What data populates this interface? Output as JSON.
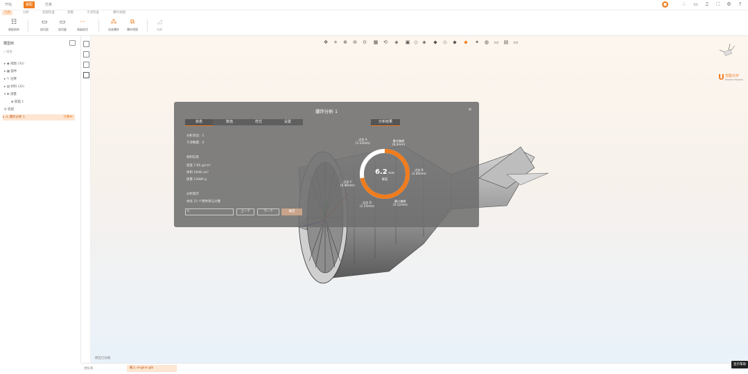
{
  "topbar": {
    "tabs": [
      "开始",
      "装配",
      "仿真",
      "渲染",
      "显示",
      "工具",
      "视图"
    ],
    "active_tab": "装配"
  },
  "ribbon": {
    "subtabs": [
      "几何",
      "分析",
      "装配检查",
      "测量",
      "干涉检查",
      "爆炸视图"
    ],
    "buttons": [
      "装配结构",
      "剖切面",
      "剖切盒",
      "高级剖切",
      "动态爆炸",
      "爆炸视图",
      "隐藏"
    ]
  },
  "left_panel": {
    "title": "模型树",
    "search_placeholder": "搜索",
    "tree_items": [
      "视图 (32)",
      "部件",
      "注释",
      "材料 (32)",
      "测量",
      "剖面 1",
      "装配",
      "爆炸分析 1"
    ],
    "selected_tag": "计算中"
  },
  "dialog": {
    "title": "爆炸分析 1",
    "tabs": [
      "状态",
      "数值",
      "样式",
      "设置"
    ],
    "right_tab": "分析结果",
    "lines": [
      "分析状态：1",
      "干涉数量：0",
      "材料信息",
      "密度 7.85 g/cm³",
      "体积 1648 cm³",
      "质量 12680 g",
      "分析提示",
      "共有 15 个零件参与计算"
    ],
    "input_value": "0",
    "buttons": [
      "上一个",
      "下一个",
      "确定"
    ],
    "gauge": {
      "value": "6.2",
      "unit": "mm",
      "caption": "偏差",
      "fraction": 0.72
    },
    "point_labels": [
      "点位 A\n(1.12mm)",
      "最大偏差\n(6.2mm)",
      "点位 B\n(3.40mm)",
      "点位 C\n(0.86mm)",
      "点位 D\n(2.15mm)",
      "最小偏差\n(0.12mm)"
    ]
  },
  "viewport": {
    "logo_text": "优联元宇",
    "logo_sub": "YouLian Universe",
    "bottom_label": "模型已加载"
  },
  "statusbar": {
    "left_text": "坐标系",
    "center_text": "载入 engine.glb",
    "right_button": "显示帮助"
  },
  "colors": {
    "accent": "#f07c1e",
    "dialog": "#6e6e6e"
  }
}
